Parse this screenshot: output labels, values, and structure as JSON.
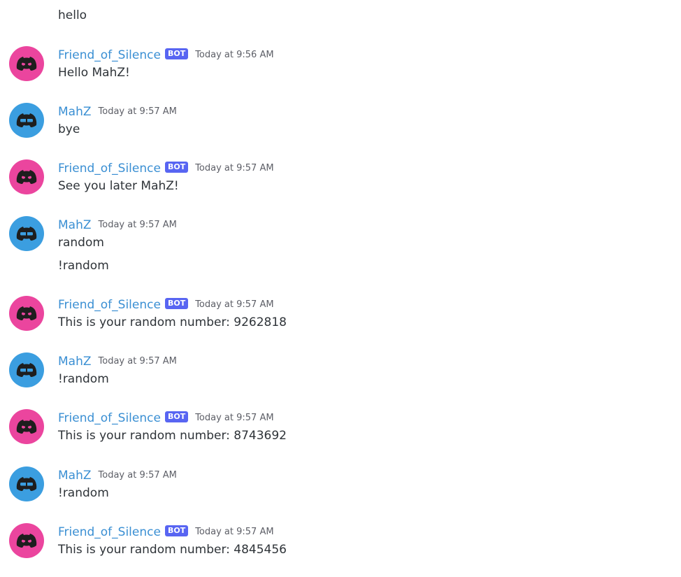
{
  "colors": {
    "bot_avatar": "#eb459e",
    "user_avatar": "#3b9ee0",
    "username": "#3a8fd3",
    "bot_tag": "#5865f2",
    "text": "#2e3338",
    "timestamp": "#5c5e66"
  },
  "top_message": "hello",
  "messages": [
    {
      "author": "Friend_of_Silence",
      "bot_tag": "BOT",
      "time": "Today at 9:56 AM",
      "lines": [
        "Hello MahZ!"
      ]
    },
    {
      "author": "MahZ",
      "time": "Today at 9:57 AM",
      "lines": [
        "bye"
      ]
    },
    {
      "author": "Friend_of_Silence",
      "bot_tag": "BOT",
      "time": "Today at 9:57 AM",
      "lines": [
        "See you later MahZ!"
      ]
    },
    {
      "author": "MahZ",
      "time": "Today at 9:57 AM",
      "lines": [
        "random",
        "!random"
      ]
    },
    {
      "author": "Friend_of_Silence",
      "bot_tag": "BOT",
      "time": "Today at 9:57 AM",
      "lines": [
        "This is your random number: 9262818"
      ]
    },
    {
      "author": "MahZ",
      "time": "Today at 9:57 AM",
      "lines": [
        "!random"
      ]
    },
    {
      "author": "Friend_of_Silence",
      "bot_tag": "BOT",
      "time": "Today at 9:57 AM",
      "lines": [
        "This is your random number: 8743692"
      ]
    },
    {
      "author": "MahZ",
      "time": "Today at 9:57 AM",
      "lines": [
        "!random"
      ]
    },
    {
      "author": "Friend_of_Silence",
      "bot_tag": "BOT",
      "time": "Today at 9:57 AM",
      "lines": [
        "This is your random number: 4845456"
      ]
    }
  ]
}
